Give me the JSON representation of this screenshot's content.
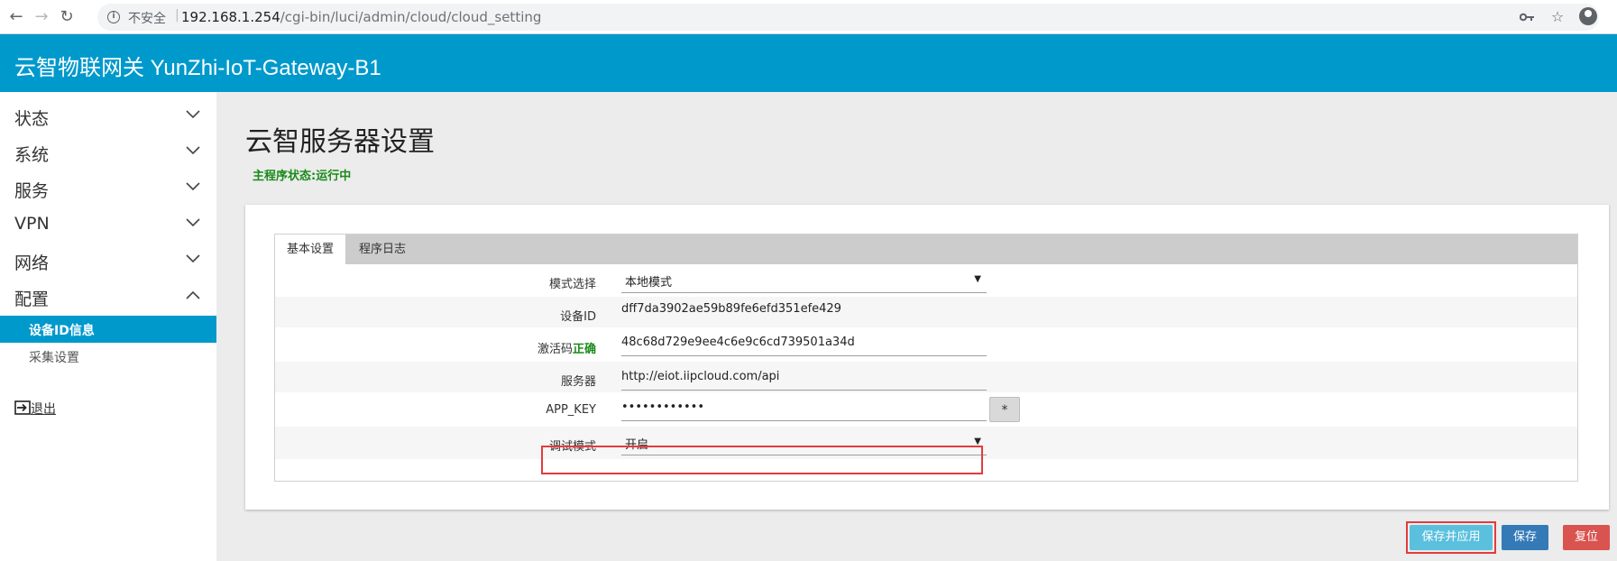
{
  "browser": {
    "back_icon": "arrow-left",
    "forward_icon": "arrow-right",
    "reload_icon": "reload",
    "insecure_label": "不安全",
    "url_host": "192.168.1.254",
    "url_path": "/cgi-bin/luci/admin/cloud/cloud_setting"
  },
  "header": {
    "title": "云智物联网关 YunZhi-IoT-Gateway-B1"
  },
  "sidebar": {
    "items": [
      {
        "label": "状态",
        "expanded": false
      },
      {
        "label": "系统",
        "expanded": false
      },
      {
        "label": "服务",
        "expanded": false
      },
      {
        "label": "VPN",
        "expanded": false
      },
      {
        "label": "网络",
        "expanded": false
      },
      {
        "label": "配置",
        "expanded": true
      }
    ],
    "sub_items": [
      {
        "label": "设备ID信息",
        "active": true
      },
      {
        "label": "采集设置",
        "active": false
      }
    ],
    "logout_label": "退出"
  },
  "main": {
    "title": "云智服务器设置",
    "status": "主程序状态:运行中",
    "tabs": [
      {
        "label": "基本设置",
        "active": true
      },
      {
        "label": "程序日志",
        "active": false
      }
    ],
    "fields": {
      "mode": {
        "label": "模式选择",
        "value": "本地模式"
      },
      "device_id": {
        "label": "设备ID",
        "value": "dff7da3902ae59b89fe6efd351efe429"
      },
      "activation": {
        "label": "激活码",
        "status": "正确",
        "value": "48c68d729e9ee4c6e9c6cd739501a34d"
      },
      "server": {
        "label": "服务器",
        "value": "http://eiot.iipcloud.com/api"
      },
      "app_key": {
        "label": "APP_KEY",
        "value": "••••••••••••",
        "reveal_label": "*"
      },
      "debug": {
        "label": "调试模式",
        "value": "开启"
      }
    }
  },
  "actions": {
    "apply": "保存并应用",
    "save": "保存",
    "reset": "复位"
  },
  "colors": {
    "header": "#0099cc",
    "active_item": "#0099cc",
    "status_green": "#1a8a1a",
    "apply": "#5bc0de",
    "save": "#337ab7",
    "reset": "#d9534f",
    "highlight": "#e23c3c"
  }
}
